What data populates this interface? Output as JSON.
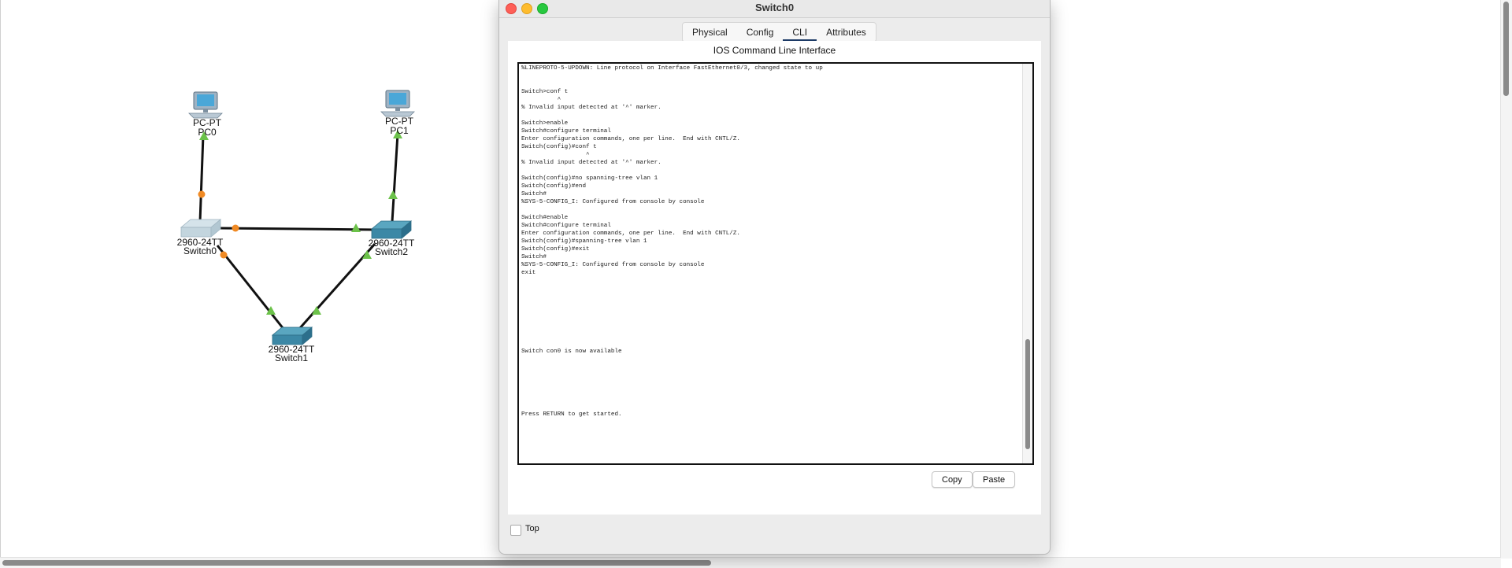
{
  "window": {
    "title": "Switch0",
    "tabs": [
      {
        "label": "Physical",
        "active": false
      },
      {
        "label": "Config",
        "active": false
      },
      {
        "label": "CLI",
        "active": true
      },
      {
        "label": "Attributes",
        "active": false
      }
    ],
    "panel_title": "IOS Command Line Interface",
    "cli_text": "%LINEPROTO-5-UPDOWN: Line protocol on Interface FastEthernet0/3, changed state to up\n\n\nSwitch>conf t\n          ^\n% Invalid input detected at '^' marker.\n\nSwitch>enable\nSwitch#configure terminal\nEnter configuration commands, one per line.  End with CNTL/Z.\nSwitch(config)#conf t\n                  ^\n% Invalid input detected at '^' marker.\n\nSwitch(config)#no spanning-tree vlan 1\nSwitch(config)#end\nSwitch#\n%SYS-5-CONFIG_I: Configured from console by console\n\nSwitch#enable\nSwitch#configure terminal\nEnter configuration commands, one per line.  End with CNTL/Z.\nSwitch(config)#spanning-tree vlan 1\nSwitch(config)#exit\nSwitch#\n%SYS-5-CONFIG_I: Configured from console by console\nexit\n\n\n\n\n\n\n\n\n\nSwitch con0 is now available\n\n\n\n\n\n\n\nPress RETURN to get started.",
    "copy_label": "Copy",
    "paste_label": "Paste",
    "top_label": "Top",
    "top_checked": false
  },
  "topology": {
    "devices": [
      {
        "id": "pc0",
        "model": "PC-PT",
        "name": "PC0",
        "icon": "pc-icon"
      },
      {
        "id": "pc1",
        "model": "PC-PT",
        "name": "PC1",
        "icon": "pc-icon"
      },
      {
        "id": "switch0",
        "model": "2960-24TT",
        "name": "Switch0",
        "icon": "switch-icon"
      },
      {
        "id": "switch2",
        "model": "2960-24TT",
        "name": "Switch2",
        "icon": "switch-icon"
      },
      {
        "id": "switch1",
        "model": "2960-24TT",
        "name": "Switch1",
        "icon": "switch-icon"
      }
    ],
    "link_colors": {
      "up": "#6cc24a",
      "blocking": "#f08a24"
    }
  }
}
